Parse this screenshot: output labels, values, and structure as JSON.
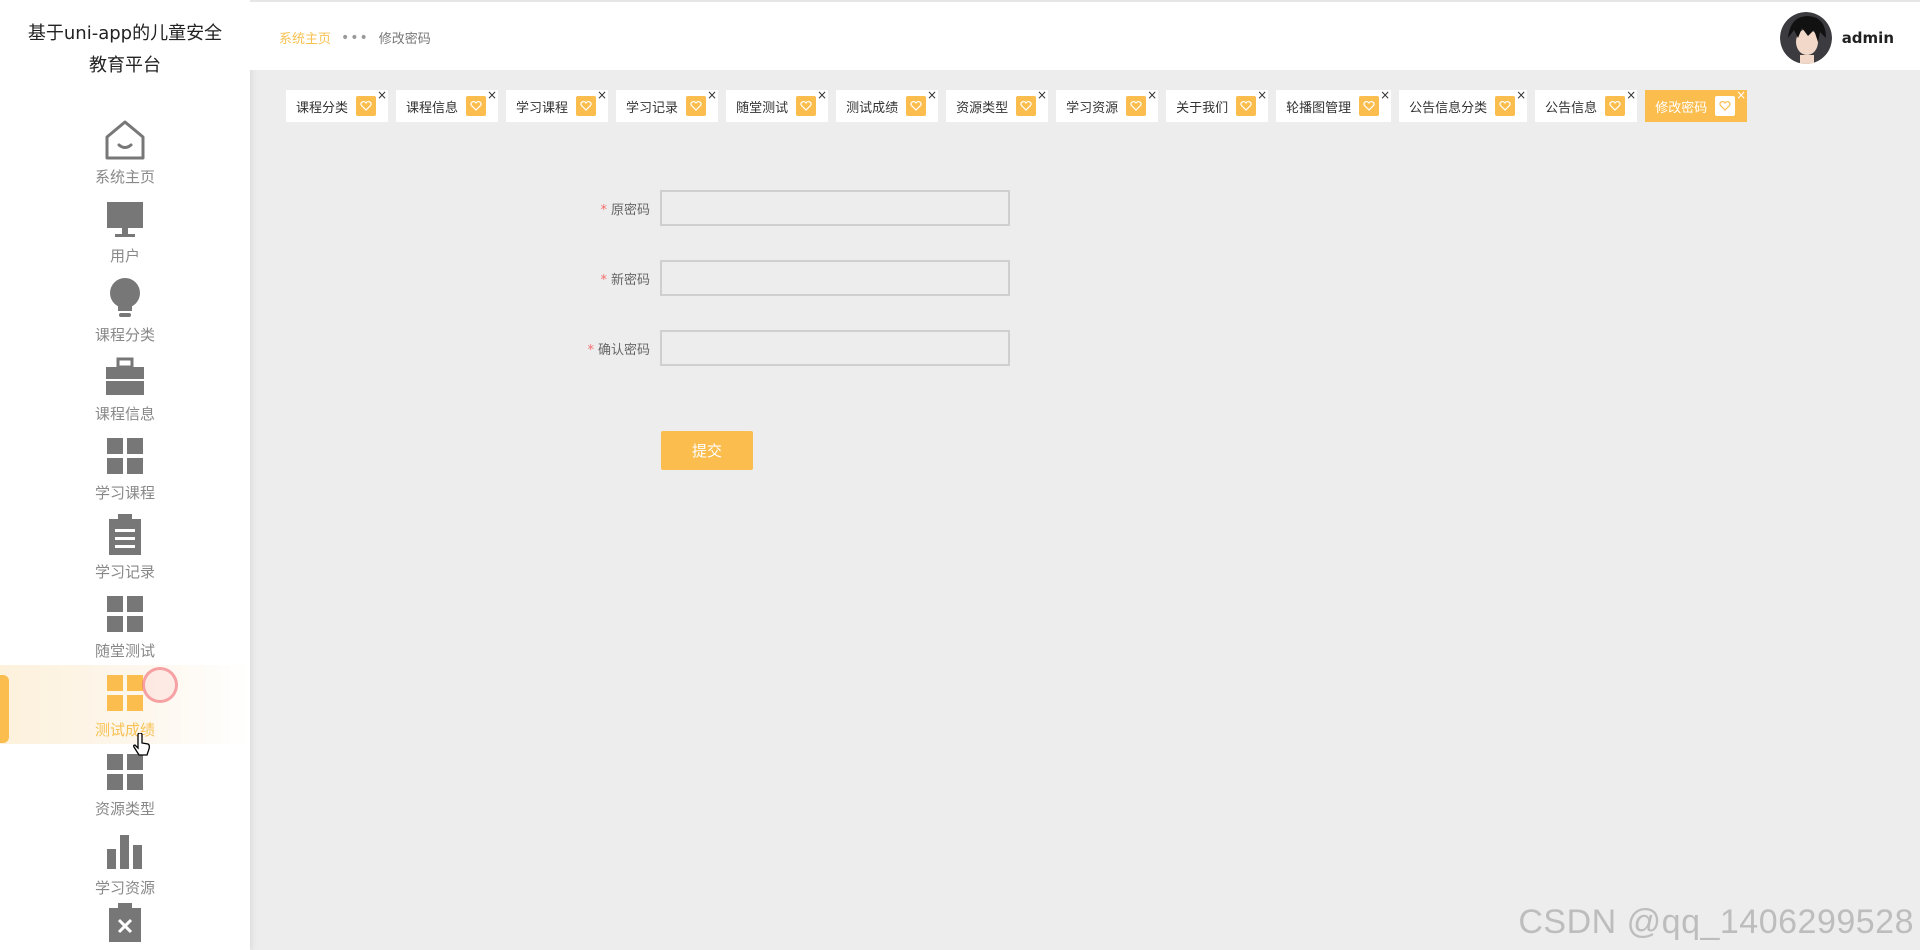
{
  "sidebar": {
    "brand": "基于uni-app的儿童安全教育平台",
    "items": [
      {
        "label": "系统主页",
        "icon": "house-icon"
      },
      {
        "label": "用户",
        "icon": "monitor-icon"
      },
      {
        "label": "课程分类",
        "icon": "bulb-icon"
      },
      {
        "label": "课程信息",
        "icon": "briefcase-icon"
      },
      {
        "label": "学习课程",
        "icon": "grid-icon"
      },
      {
        "label": "学习记录",
        "icon": "clipboard-icon"
      },
      {
        "label": "随堂测试",
        "icon": "grid-icon"
      },
      {
        "label": "测试成绩",
        "icon": "grid-icon",
        "active": true
      },
      {
        "label": "资源类型",
        "icon": "grid-icon"
      },
      {
        "label": "学习资源",
        "icon": "bar-chart-icon"
      }
    ]
  },
  "header": {
    "breadcrumb_home": "系统主页",
    "breadcrumb_sep": "•••",
    "breadcrumb_current": "修改密码",
    "username": "admin"
  },
  "tags": [
    {
      "label": "课程分类"
    },
    {
      "label": "课程信息"
    },
    {
      "label": "学习课程"
    },
    {
      "label": "学习记录"
    },
    {
      "label": "随堂测试"
    },
    {
      "label": "测试成绩"
    },
    {
      "label": "资源类型"
    },
    {
      "label": "学习资源"
    },
    {
      "label": "关于我们"
    },
    {
      "label": "轮播图管理"
    },
    {
      "label": "公告信息分类"
    },
    {
      "label": "公告信息"
    },
    {
      "label": "修改密码",
      "active": true
    }
  ],
  "form": {
    "required_mark": "*",
    "old_password_label": "原密码",
    "new_password_label": "新密码",
    "confirm_password_label": "确认密码",
    "old_password_value": "",
    "new_password_value": "",
    "confirm_password_value": "",
    "submit_label": "提交"
  },
  "watermark": "CSDN @qq_1406299528",
  "colors": {
    "accent": "#fbbd4e",
    "background": "#ededed",
    "required": "#f56c6c"
  }
}
